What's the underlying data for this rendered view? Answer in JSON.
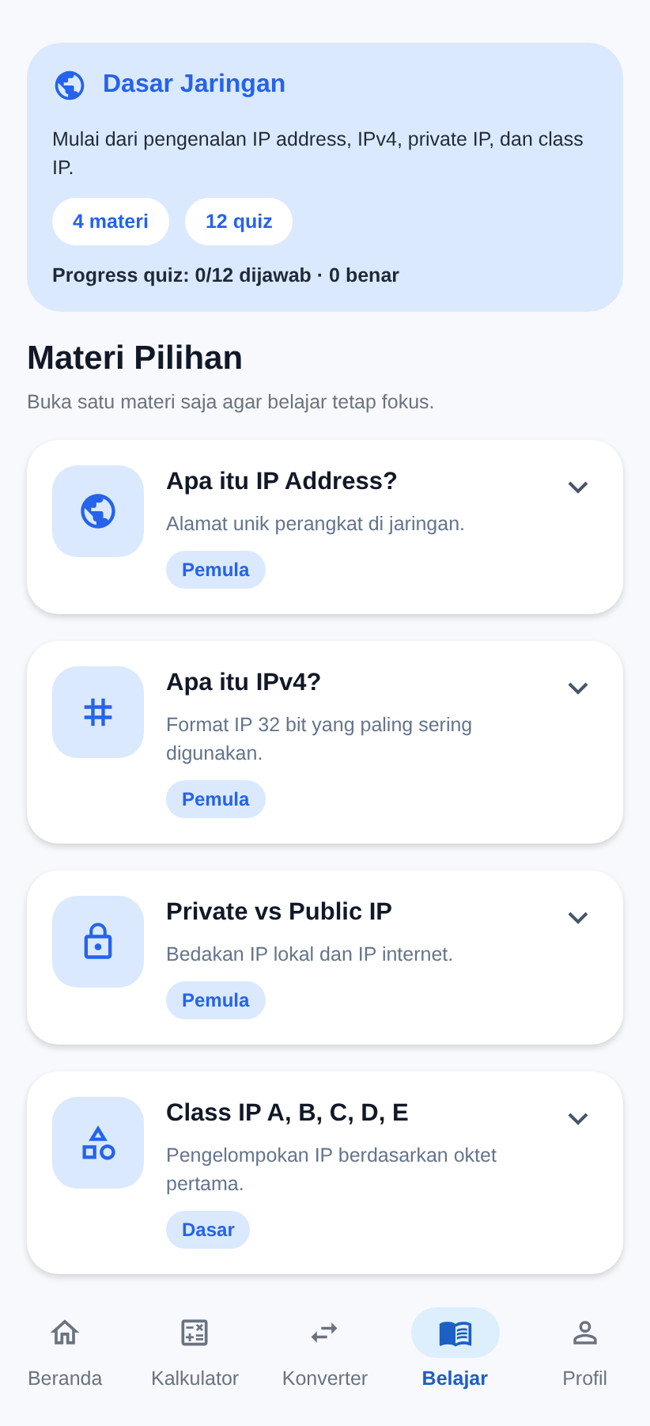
{
  "hero": {
    "title": "Dasar Jaringan",
    "description": "Mulai dari pengenalan IP address, IPv4, private IP, dan class IP.",
    "chips": [
      "4 materi",
      "12 quiz"
    ],
    "progress": "Progress quiz: 0/12 dijawab · 0 benar"
  },
  "section": {
    "title": "Materi Pilihan",
    "subtitle": "Buka satu materi saja agar belajar tetap fokus."
  },
  "lessons": [
    {
      "kind": "globe",
      "title": "Apa itu IP Address?",
      "description": "Alamat unik perangkat di jaringan.",
      "level": "Pemula",
      "expanded": false
    },
    {
      "kind": "hash",
      "title": "Apa itu IPv4?",
      "description": "Format IP 32 bit yang paling sering digunakan.",
      "level": "Pemula",
      "expanded": false
    },
    {
      "kind": "lock",
      "title": "Private vs Public IP",
      "description": "Bedakan IP lokal dan IP internet.",
      "level": "Pemula",
      "expanded": false
    },
    {
      "kind": "shapes",
      "title": "Class IP A, B, C, D, E",
      "description": "Pengelompokan IP berdasarkan oktet pertama.",
      "level": "Dasar",
      "expanded": false
    }
  ],
  "nav": [
    {
      "kind": "home",
      "label": "Beranda",
      "selected": false
    },
    {
      "kind": "calculator",
      "label": "Kalkulator",
      "selected": false
    },
    {
      "kind": "swap",
      "label": "Konverter",
      "selected": false
    },
    {
      "kind": "book",
      "label": "Belajar",
      "selected": true
    },
    {
      "kind": "person",
      "label": "Profil",
      "selected": false
    }
  ]
}
